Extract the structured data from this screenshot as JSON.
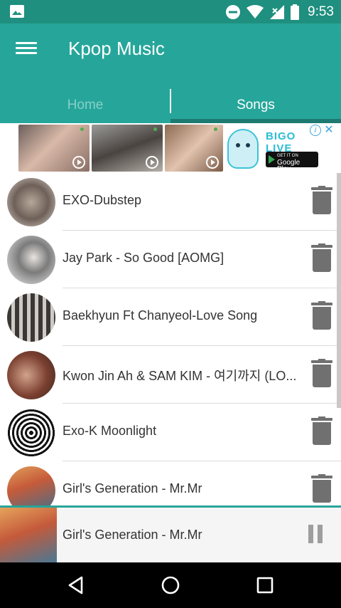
{
  "status_bar": {
    "time": "9:53",
    "icons": [
      "image-icon",
      "do-not-disturb-icon",
      "wifi-icon",
      "signal-icon",
      "battery-icon"
    ]
  },
  "app": {
    "title": "Kpop Music"
  },
  "tabs": [
    {
      "label": "Home",
      "active": false
    },
    {
      "label": "Songs",
      "active": true
    }
  ],
  "ad": {
    "brand": "BIGO LIVE",
    "store_small": "GET IT ON",
    "store": "Google Play",
    "info": "i",
    "close": "✕"
  },
  "songs": [
    {
      "title": "EXO-Dubstep"
    },
    {
      "title": "Jay Park - So Good [AOMG]"
    },
    {
      "title": "Baekhyun Ft Chanyeol-Love Song"
    },
    {
      "title": "Kwon Jin Ah & SAM KIM - 여기까지 (LO..."
    },
    {
      "title": "Exo-K Moonlight"
    },
    {
      "title": "Girl's Generation - Mr.Mr"
    }
  ],
  "now_playing": {
    "title": "Girl's Generation - Mr.Mr"
  },
  "colors": {
    "primary": "#26a69a",
    "status": "#1f8f7f",
    "indicator": "#1d7a70",
    "icon_gray": "#707070"
  }
}
